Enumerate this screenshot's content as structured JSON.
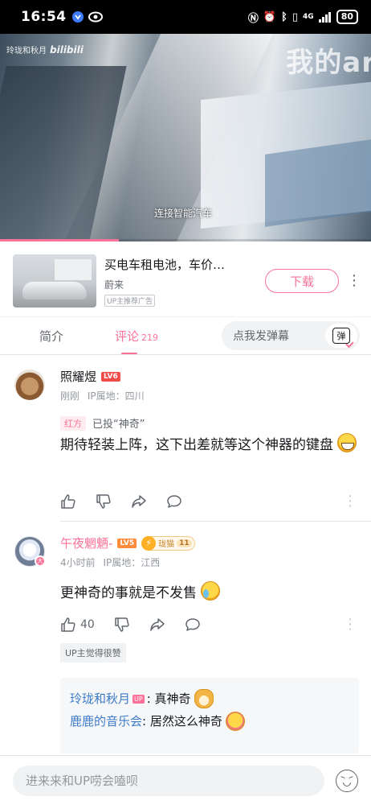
{
  "status_bar": {
    "time": "16:54",
    "network": "4G",
    "battery": "80"
  },
  "video": {
    "watermark_name": "玲珑和秋月",
    "watermark_logo": "bilibili",
    "overlay_text": "我的ar",
    "subtitle": "连接智能汽车",
    "progress_fraction": 0.32
  },
  "ad": {
    "title": "买电车租电池，车价…",
    "brand": "蔚来",
    "tag": "UP主推荐广告",
    "download_label": "下载"
  },
  "tabs": {
    "intro": "简介",
    "comments": "评论",
    "comments_count": "219",
    "danmaku_placeholder": "点我发弹幕",
    "danmaku_button": "弹"
  },
  "comments": [
    {
      "username": "照耀煜",
      "level": "LV6",
      "time": "刚刚",
      "ip": "IP属地：四川",
      "vote_team": "红方",
      "vote_text": "已投“神奇”",
      "text": "期待轻装上阵，这下出差就等这个神器的键盘",
      "emoji": "grin-emoji"
    },
    {
      "username": "午夜魍魉-",
      "level": "LV5",
      "fan_badge": "珑猫",
      "fan_level": "11",
      "avatar_badge": "大",
      "time": "4小时前",
      "ip": "IP属地：江西",
      "text": "更神奇的事就是不发售",
      "emoji": "cry-emoji",
      "likes": "40",
      "up_liked": "UP主觉得很赞",
      "replies": [
        {
          "name": "玲珑和秋月",
          "up_tag": "UP",
          "text": ": 真神奇",
          "emoji": "doge-emoji"
        },
        {
          "name": "鹿鹿的音乐会",
          "text": ": 居然这么神奇",
          "emoji": "kiss-emoji"
        }
      ]
    }
  ],
  "bottom": {
    "input_placeholder": "进来来和UP唠会嗑呗"
  },
  "colors": {
    "accent": "#fb7299",
    "link": "#3d7cc9",
    "muted": "#9499a0"
  }
}
